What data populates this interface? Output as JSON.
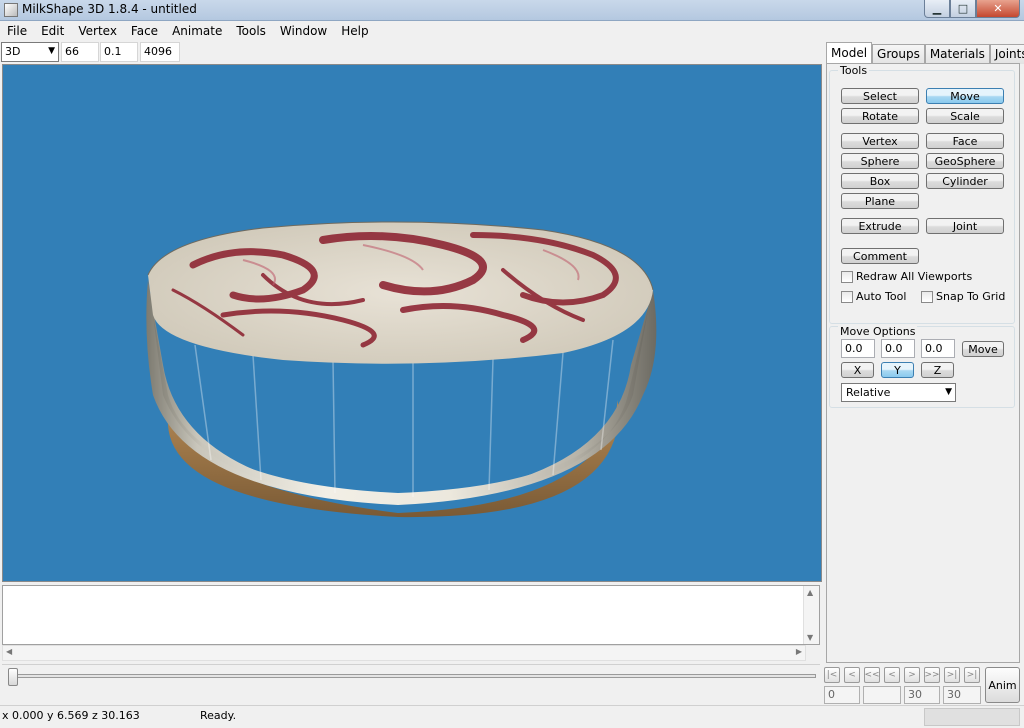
{
  "window": {
    "title": "MilkShape 3D 1.8.4 - untitled",
    "controls": {
      "minimize": "▁",
      "maximize": "□",
      "close": "✕"
    }
  },
  "menu": [
    "File",
    "Edit",
    "Vertex",
    "Face",
    "Animate",
    "Tools",
    "Window",
    "Help"
  ],
  "toolbar": {
    "view_mode": "3D",
    "field1": "66",
    "field2": "0.1",
    "field3": "4096"
  },
  "panel": {
    "tabs": [
      "Model",
      "Groups",
      "Materials",
      "Joints"
    ],
    "active_tab": "Model",
    "tools": {
      "title": "Tools",
      "buttons": {
        "select": "Select",
        "move": "Move",
        "rotate": "Rotate",
        "scale": "Scale",
        "vertex": "Vertex",
        "face": "Face",
        "sphere": "Sphere",
        "geosphere": "GeoSphere",
        "box": "Box",
        "cylinder": "Cylinder",
        "plane": "Plane",
        "extrude": "Extrude",
        "joint": "Joint",
        "comment": "Comment"
      },
      "pressed": "Move",
      "checkboxes": {
        "redraw_all": {
          "label": "Redraw All Viewports",
          "checked": false
        },
        "auto_tool": {
          "label": "Auto Tool",
          "checked": false
        },
        "snap_to_grid": {
          "label": "Snap To Grid",
          "checked": false
        }
      }
    },
    "move_options": {
      "title": "Move Options",
      "x_value": "0.0",
      "y_value": "0.0",
      "z_value": "0.0",
      "move_label": "Move",
      "axis_buttons": {
        "x": "X",
        "y": "Y",
        "z": "Z"
      },
      "axis_pressed": "Y",
      "mode": "Relative"
    }
  },
  "timeline": {
    "controls": [
      "|<",
      "<",
      "<<",
      "<",
      ">",
      ">>",
      ">|",
      ">|"
    ],
    "current_frame": "0",
    "blank": "",
    "end_frame": "30",
    "total_frames": "30",
    "anim_label": "Anim"
  },
  "status": {
    "coords": "x 0.000 y 6.569 z 30.163",
    "message": "Ready."
  },
  "colors": {
    "viewport_bg": "#327fb7",
    "pressed_button": "#a9d8f2"
  }
}
